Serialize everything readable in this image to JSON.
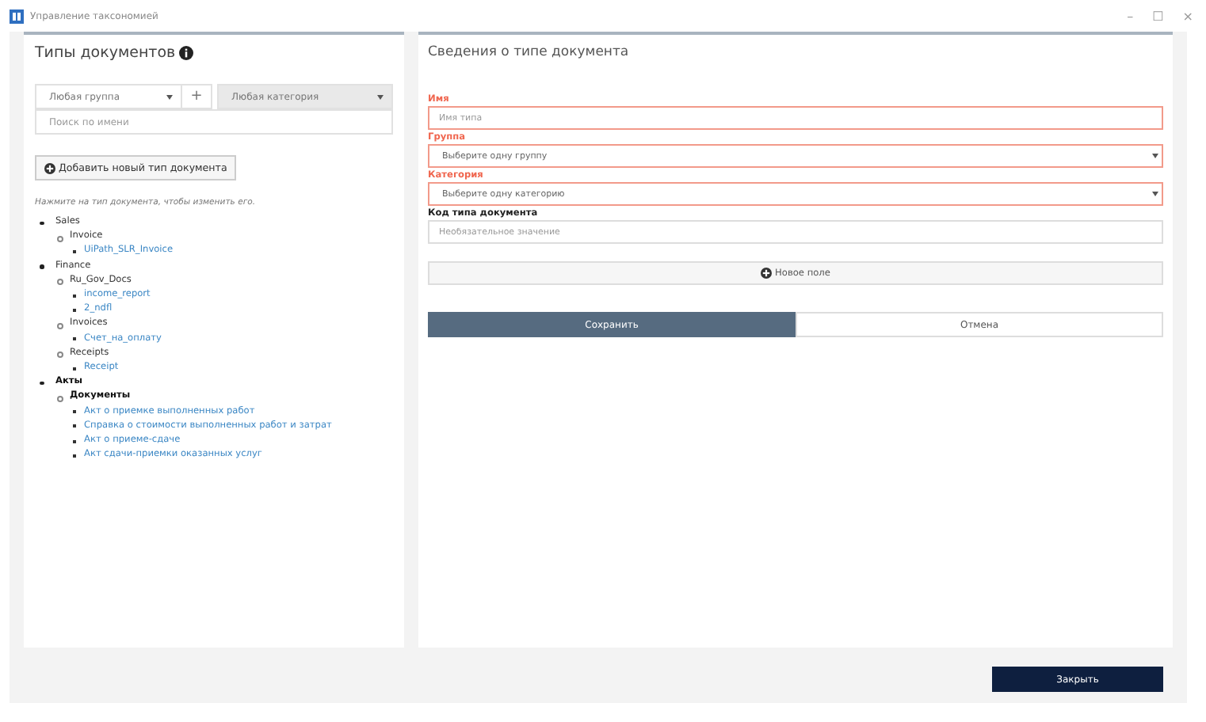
{
  "window": {
    "title": "Управление таксономией",
    "controls": [
      "–",
      "☐",
      "×"
    ]
  },
  "left": {
    "title": "Типы документов",
    "group_filter": "Любая группа",
    "add_symbol": "+",
    "category_filter": "Любая категория",
    "search": {
      "placeholder": "Поиск по имени"
    },
    "add_button": "Добавить новый тип документа",
    "hint": "Нажмите на тип документа, чтобы изменить его.",
    "tree": [
      {
        "label": "Sales",
        "bold": false,
        "children": [
          {
            "label": "Invoice",
            "bold": false,
            "children": [
              {
                "label": "UiPath_SLR_Invoice"
              }
            ]
          }
        ]
      },
      {
        "label": "Finance",
        "bold": false,
        "children": [
          {
            "label": "Ru_Gov_Docs",
            "bold": false,
            "children": [
              {
                "label": "income_report"
              },
              {
                "label": "2_ndfl"
              }
            ]
          },
          {
            "label": "Invoices",
            "bold": false,
            "children": [
              {
                "label": "Счет_на_оплату"
              }
            ]
          },
          {
            "label": "Receipts",
            "bold": false,
            "children": [
              {
                "label": "Receipt"
              }
            ]
          }
        ]
      },
      {
        "label": "Акты",
        "bold": true,
        "children": [
          {
            "label": "Документы",
            "bold": true,
            "children": [
              {
                "label": "Акт о приемке выполненных работ"
              },
              {
                "label": "Справка о стоимости выполненных работ и затрат"
              },
              {
                "label": "Акт о приеме-сдаче"
              },
              {
                "label": "Акт сдачи-приемки оказанных услуг"
              }
            ]
          }
        ]
      }
    ]
  },
  "right": {
    "title": "Сведения о типе документа",
    "fields": [
      {
        "kind": "text",
        "label": "Имя",
        "placeholder": "Имя типа",
        "invalid": true
      },
      {
        "kind": "select",
        "label": "Группа",
        "placeholder": "Выберите одну группу",
        "invalid": true
      },
      {
        "kind": "select",
        "label": "Категория",
        "placeholder": "Выберите одну категорию",
        "invalid": true
      },
      {
        "kind": "text",
        "label": "Код типа документа",
        "placeholder": "Необязательное значение",
        "invalid": false
      }
    ],
    "new_field_button": "Новое поле",
    "save_button": "Сохранить",
    "cancel_button": "Отмена"
  },
  "close_button": "Закрыть"
}
